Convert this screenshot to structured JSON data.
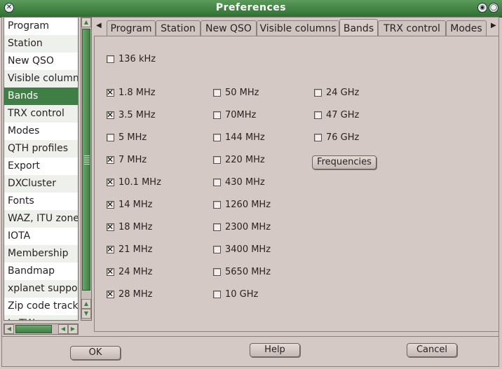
{
  "window": {
    "title": "Preferences",
    "close_glyph": "✕",
    "min_glyph": "◉",
    "max_glyph": "◯"
  },
  "sidebar": {
    "items": [
      "Program",
      "Station",
      "New QSO",
      "Visible columns",
      "Bands",
      "TRX control",
      "Modes",
      "QTH profiles",
      "Export",
      "DXCluster",
      "Fonts",
      "WAZ, ITU zone",
      "IOTA",
      "Membership",
      "Bandmap",
      "xplanet suppor",
      "Zip code tracki",
      "LoTW"
    ],
    "selected": "Bands"
  },
  "tabs": [
    "Program",
    "Station",
    "New QSO",
    "Visible columns",
    "Bands",
    "TRX control",
    "Modes"
  ],
  "active_tab": "Bands",
  "bands": {
    "low": {
      "label": "136 kHz",
      "checked": false
    },
    "col1": [
      {
        "label": "1.8 MHz",
        "checked": true
      },
      {
        "label": "3.5 MHz",
        "checked": true
      },
      {
        "label": "5 MHz",
        "checked": false
      },
      {
        "label": "7 MHz",
        "checked": true
      },
      {
        "label": "10.1 MHz",
        "checked": true
      },
      {
        "label": "14 MHz",
        "checked": true
      },
      {
        "label": "18 MHz",
        "checked": true
      },
      {
        "label": "21 MHz",
        "checked": true
      },
      {
        "label": "24 MHz",
        "checked": true
      },
      {
        "label": "28 MHz",
        "checked": true
      }
    ],
    "col2": [
      {
        "label": "50 MHz",
        "checked": false
      },
      {
        "label": "70MHz",
        "checked": false
      },
      {
        "label": "144 MHz",
        "checked": false
      },
      {
        "label": "220 MHz",
        "checked": false
      },
      {
        "label": "430 MHz",
        "checked": false
      },
      {
        "label": "1260 MHz",
        "checked": false
      },
      {
        "label": "2300 MHz",
        "checked": false
      },
      {
        "label": "3400 MHz",
        "checked": false
      },
      {
        "label": "5650 MHz",
        "checked": false
      },
      {
        "label": "10 GHz",
        "checked": false
      }
    ],
    "col3": [
      {
        "label": "24 GHz",
        "checked": false
      },
      {
        "label": "47 GHz",
        "checked": false
      },
      {
        "label": "76 GHz",
        "checked": false
      }
    ],
    "frequencies_button": "Frequencies"
  },
  "footer": {
    "ok": "OK",
    "help": "Help",
    "cancel": "Cancel"
  },
  "colors": {
    "accent": "#3f7e44",
    "titlebar": "#2f6f32",
    "background": "#d4c9c4"
  }
}
